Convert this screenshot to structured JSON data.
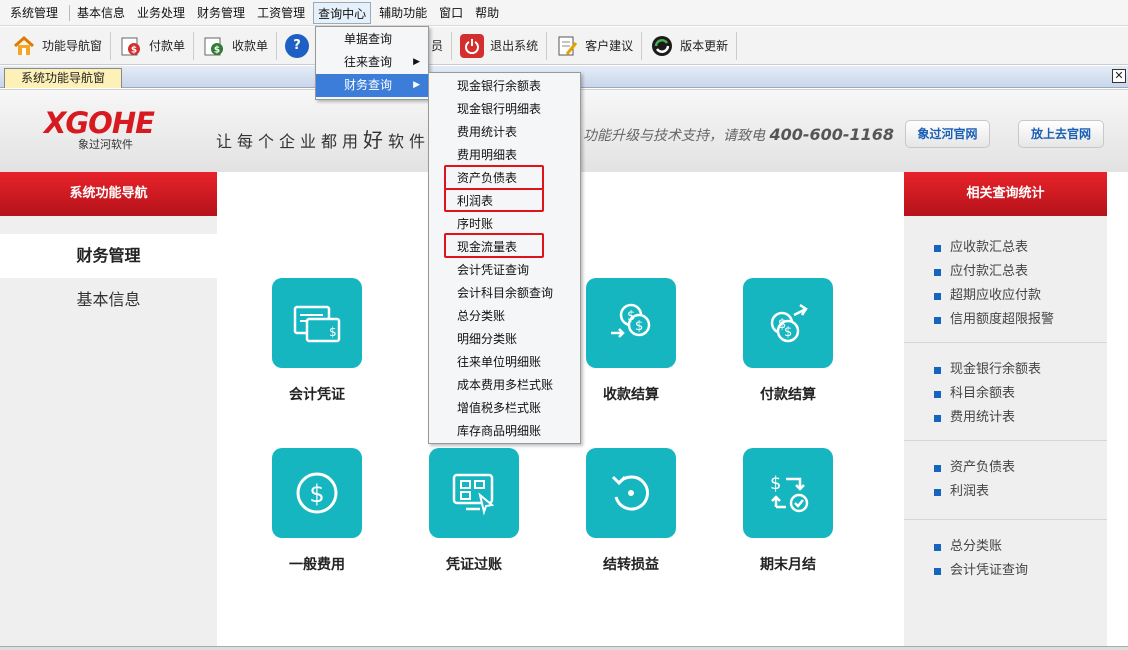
{
  "menubar": [
    "系统管理",
    "基本信息",
    "业务处理",
    "财务管理",
    "工资管理",
    "查询中心",
    "辅助功能",
    "窗口",
    "帮助"
  ],
  "toolbar": [
    {
      "label": "功能导航窗",
      "icon": "home-icon"
    },
    {
      "label": "付款单",
      "icon": "payment-icon"
    },
    {
      "label": "收款单",
      "icon": "receipt-icon"
    },
    {
      "label": "",
      "icon": "help-icon"
    },
    {
      "label": "员",
      "icon": "user-icon"
    },
    {
      "label": "退出系统",
      "icon": "power-icon"
    },
    {
      "label": "客户建议",
      "icon": "note-icon"
    },
    {
      "label": "版本更新",
      "icon": "update-icon"
    }
  ],
  "tab": {
    "label": "系统功能导航窗",
    "close": "✕"
  },
  "banner": {
    "logo": "XGOHE",
    "logo_sub": "象过河软件",
    "slogan_a": "让每个企业都用",
    "slogan_big": "好",
    "slogan_b": "软件",
    "slogan2": "功能升级与技术支持，请致电",
    "phone": "400-600-1168",
    "btn_official": "象过河官网",
    "btn_web": "放上去官网"
  },
  "leftnav": {
    "title": "系统功能导航",
    "items": [
      "财务管理",
      "基本信息"
    ]
  },
  "tiles": [
    "会计凭证",
    "",
    "收款结算",
    "付款结算",
    "一般费用",
    "凭证过账",
    "结转损益",
    "期末月结"
  ],
  "rightpanel": {
    "title": "相关查询统计",
    "groups": [
      [
        "应收款汇总表",
        "应付款汇总表",
        "超期应收应付款",
        "信用额度超限报警"
      ],
      [
        "现金银行余额表",
        "科目余额表",
        "费用统计表"
      ],
      [
        "资产负债表",
        "利润表"
      ],
      [
        "总分类账",
        "会计凭证查询"
      ]
    ]
  },
  "menu_query": [
    "单据查询",
    "往来查询",
    "财务查询"
  ],
  "menu_finance": [
    "现金银行余额表",
    "现金银行明细表",
    "费用统计表",
    "费用明细表",
    "资产负债表",
    "利润表",
    "序时账",
    "现金流量表",
    "会计凭证查询",
    "会计科目余额查询",
    "总分类账",
    "明细分类账",
    "往来单位明细账",
    "成本费用多栏式账",
    "增值税多栏式账",
    "库存商品明细账"
  ],
  "colors": {
    "tile": "#16b6c0",
    "header_red": "#d71920",
    "menu_highlight": "#3b7dd8",
    "annotation_red": "#e0121a"
  }
}
